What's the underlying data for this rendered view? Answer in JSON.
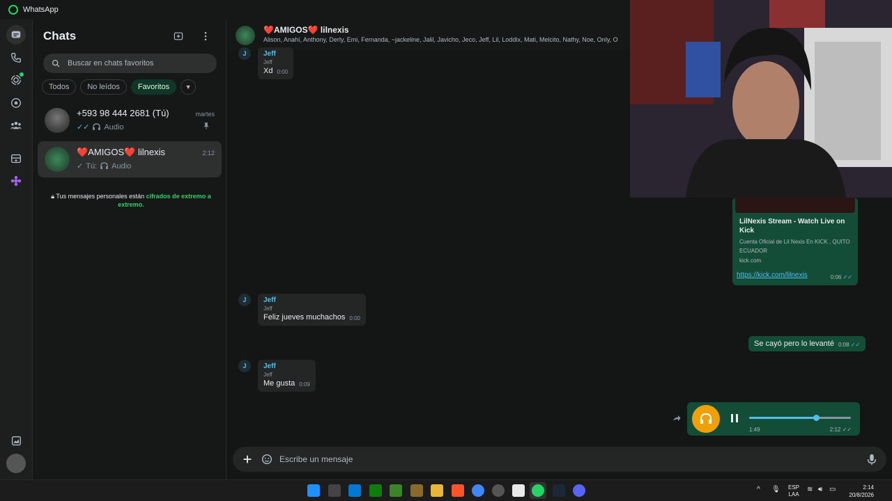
{
  "window": {
    "title": "WhatsApp"
  },
  "colors": {
    "accent": "#25d366",
    "outgoing_bubble": "#144d37",
    "incoming_bubble": "#242626",
    "sender_name": "#53bdeb",
    "audio_button": "#f0a10a"
  },
  "rail": {
    "icons": [
      "chats-icon",
      "calls-icon",
      "status-icon",
      "channels-icon",
      "communities-icon",
      "archived-icon",
      "meta-ai-icon",
      "media-icon",
      "profile-avatar"
    ]
  },
  "sidebar": {
    "title": "Chats",
    "search_placeholder": "Buscar en chats favoritos",
    "filters": [
      "Todos",
      "No leídos",
      "Favoritos"
    ],
    "active_filter": "Favoritos",
    "chats": [
      {
        "name": "+593 98 444 2681 (Tú)",
        "time": "martes",
        "preview": "Audio",
        "pinned": true
      },
      {
        "name_prefix": "❤️",
        "name": "AMIGOS",
        "name_suffix": "❤️ lilnexis",
        "time": "2:12",
        "preview_prefix": "Tú:",
        "preview": "Audio"
      }
    ],
    "encryption": {
      "text": "Tus mensajes personales están ",
      "highlight": "cifrados de extremo a extremo",
      "end": "."
    }
  },
  "conversation": {
    "group_prefix": "❤️",
    "group_name": "AMIGOS",
    "group_suffix": "❤️ lilnexis",
    "members": "Alison, Anahí, Anthony, Derly, Emi, Fernanda, ~jackeline, Jalil, Javicho, Jeco, Jeff, Lil, Loddix, Mati, Melcito, Nathy, Noe, Only, O",
    "messages": [
      {
        "avatar": "J",
        "sender": "Jeff",
        "sub": "Jeff",
        "text": "Xd",
        "time": "0:00"
      },
      {
        "avatar": "J",
        "sender": "Jeff",
        "sub": "Jeff",
        "text": "Feliz jueves muchachos",
        "time": "0:00"
      },
      {
        "avatar": "J",
        "sender": "Jeff",
        "sub": "Jeff",
        "text": "Me gusta",
        "time": "0:09"
      }
    ],
    "link_preview": {
      "title": "LilNexis Stream - Watch Live on Kick",
      "description": "Cuenta Oficial de Lil Nexis En KICK , QUITO ECUADOR",
      "domain": "kick.com",
      "url": "https://kick.com/lilnexis",
      "time": "0:06"
    },
    "outgoing_text": {
      "text": "Se cayó pero lo levanté",
      "time": "0:08"
    },
    "audio": {
      "elapsed": "1:49",
      "time": "2:12",
      "progress": 0.66
    },
    "composer_placeholder": "Escribe un mensaje"
  },
  "taskbar": {
    "lang": "ESP",
    "lang2": "LAA",
    "time": "2:14",
    "date": "20/8/2026"
  }
}
